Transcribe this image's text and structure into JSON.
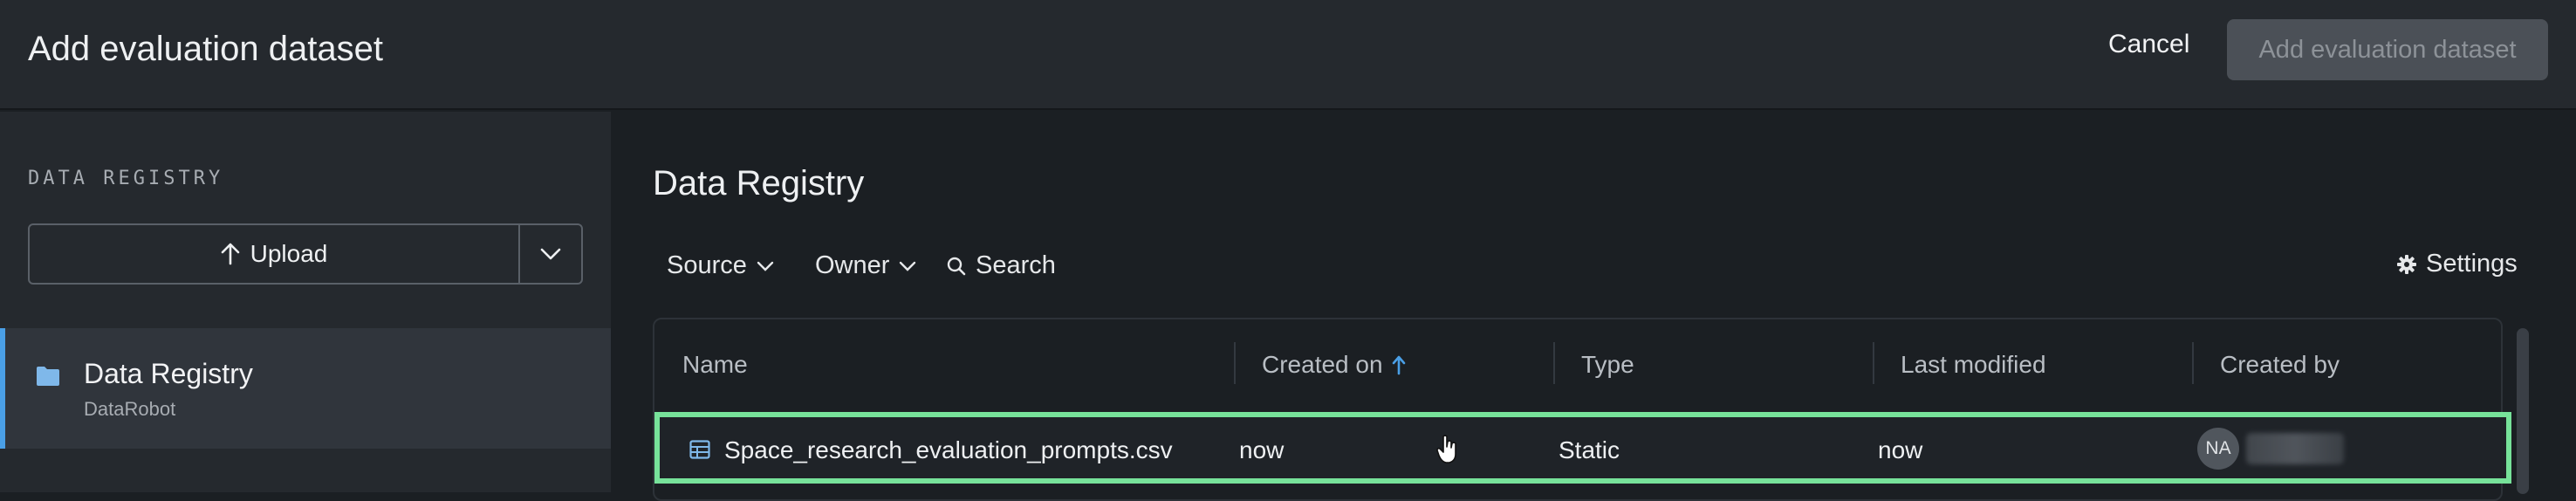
{
  "header": {
    "title": "Add evaluation dataset",
    "cancel_label": "Cancel",
    "submit_label": "Add evaluation dataset"
  },
  "sidebar": {
    "section_heading": "DATA REGISTRY",
    "upload_label": "Upload",
    "items": [
      {
        "label": "Data Registry",
        "sublabel": "DataRobot",
        "icon": "folder-icon",
        "selected": true
      }
    ]
  },
  "main": {
    "title": "Data Registry",
    "filters": {
      "source_label": "Source",
      "owner_label": "Owner",
      "search_label": "Search"
    },
    "settings_label": "Settings",
    "table": {
      "columns": [
        "Name",
        "Created on",
        "Type",
        "Last modified",
        "Created by"
      ],
      "sort_column": "Created on",
      "sort_direction": "ascending",
      "rows": [
        {
          "name": "Space_research_evaluation_prompts.csv",
          "created_on": "now",
          "type": "Static",
          "last_modified": "now",
          "created_by_initials": "NA",
          "selected": true
        }
      ]
    }
  },
  "colors": {
    "accent": "#4a9fe6",
    "selection_highlight": "#77e29a",
    "background": "#1b1f23",
    "panel": "#25292e"
  }
}
